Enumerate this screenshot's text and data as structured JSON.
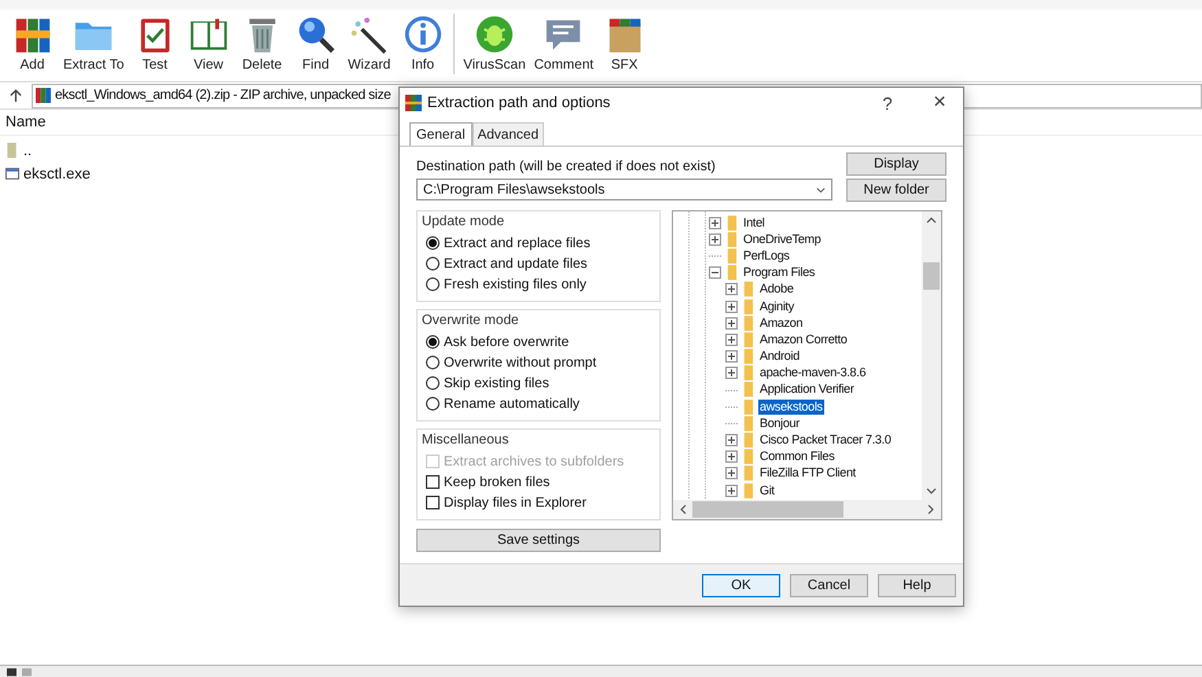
{
  "toolbar": {
    "groups": [
      [
        {
          "label": "Add",
          "kind": "books"
        },
        {
          "label": "Extract To",
          "kind": "folder"
        },
        {
          "label": "Test",
          "kind": "clipboard"
        },
        {
          "label": "View",
          "kind": "book"
        },
        {
          "label": "Delete",
          "kind": "trash"
        },
        {
          "label": "Find",
          "kind": "magnifier"
        },
        {
          "label": "Wizard",
          "kind": "wand"
        },
        {
          "label": "Info",
          "kind": "info"
        }
      ],
      [
        {
          "label": "VirusScan",
          "kind": "bug"
        },
        {
          "label": "Comment",
          "kind": "speech"
        },
        {
          "label": "SFX",
          "kind": "box"
        }
      ]
    ]
  },
  "address_bar": {
    "text": "eksctl_Windows_amd64 (2).zip - ZIP archive, unpacked size"
  },
  "file_list": {
    "columns": [
      "Name"
    ],
    "rows": [
      {
        "name": "..",
        "kind": "parent"
      },
      {
        "name": "eksctl.exe",
        "kind": "exe"
      }
    ]
  },
  "dialog": {
    "title": "Extraction path and options",
    "help_glyph": "?",
    "close_glyph": "×",
    "tabs": [
      {
        "label": "General",
        "selected": true
      },
      {
        "label": "Advanced",
        "selected": false
      }
    ],
    "destination": {
      "label": "Destination path (will be created if does not exist)",
      "value": "C:\\Program Files\\awsekstools"
    },
    "side_buttons": [
      "Display",
      "New folder"
    ],
    "radio_groups": [
      {
        "title": "Update mode",
        "options": [
          {
            "label": "Extract and replace files",
            "selected": true
          },
          {
            "label": "Extract and update files",
            "selected": false
          },
          {
            "label": "Fresh existing files only",
            "selected": false
          }
        ]
      },
      {
        "title": "Overwrite mode",
        "options": [
          {
            "label": "Ask before overwrite",
            "selected": true
          },
          {
            "label": "Overwrite without prompt",
            "selected": false
          },
          {
            "label": "Skip existing files",
            "selected": false
          },
          {
            "label": "Rename automatically",
            "selected": false
          }
        ]
      }
    ],
    "miscellaneous": {
      "title": "Miscellaneous",
      "options": [
        {
          "label": "Extract archives to subfolders",
          "checked": false,
          "disabled": true
        },
        {
          "label": "Keep broken files",
          "checked": false,
          "disabled": false
        },
        {
          "label": "Display files in Explorer",
          "checked": false,
          "disabled": false
        }
      ]
    },
    "save_button": "Save settings",
    "tree": {
      "items": [
        {
          "label": "Intel",
          "kind": "collapsed",
          "selected": false
        },
        {
          "label": "OneDriveTemp",
          "kind": "collapsed",
          "selected": false
        },
        {
          "label": "PerfLogs",
          "kind": "leaf",
          "selected": false
        },
        {
          "label": "Program Files",
          "kind": "expanded",
          "selected": false,
          "children": [
            {
              "label": "Adobe",
              "kind": "collapsed",
              "selected": false
            },
            {
              "label": "Aginity",
              "kind": "collapsed",
              "selected": false
            },
            {
              "label": "Amazon",
              "kind": "collapsed",
              "selected": false
            },
            {
              "label": "Amazon Corretto",
              "kind": "collapsed",
              "selected": false
            },
            {
              "label": "Android",
              "kind": "collapsed",
              "selected": false
            },
            {
              "label": "apache-maven-3.8.6",
              "kind": "collapsed",
              "selected": false
            },
            {
              "label": "Application Verifier",
              "kind": "leaf",
              "selected": false
            },
            {
              "label": "awsekstools",
              "kind": "leaf",
              "selected": true
            },
            {
              "label": "Bonjour",
              "kind": "leaf",
              "selected": false
            },
            {
              "label": "Cisco Packet Tracer 7.3.0",
              "kind": "collapsed",
              "selected": false
            },
            {
              "label": "Common Files",
              "kind": "collapsed",
              "selected": false
            },
            {
              "label": "FileZilla FTP Client",
              "kind": "collapsed",
              "selected": false
            },
            {
              "label": "Git",
              "kind": "collapsed",
              "selected": false
            }
          ]
        }
      ]
    },
    "buttons": [
      {
        "label": "OK",
        "default": true
      },
      {
        "label": "Cancel",
        "default": false
      },
      {
        "label": "Help",
        "default": false
      }
    ]
  }
}
